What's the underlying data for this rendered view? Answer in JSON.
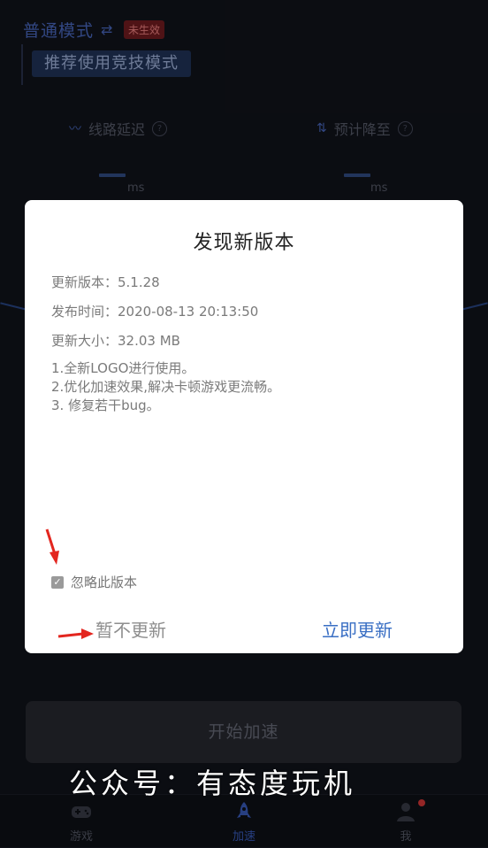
{
  "mode": {
    "title": "普通模式",
    "badge": "未生效",
    "recommend_button": "推荐使用竞技模式"
  },
  "stats": {
    "left_label": "线路延迟",
    "right_label": "预计降至",
    "left_value": "--",
    "right_value": "--",
    "left_unit": "ms",
    "right_unit": "ms"
  },
  "start_button": "开始加速",
  "tabs": [
    {
      "label": "游戏",
      "icon": "gamepad-icon"
    },
    {
      "label": "加速",
      "icon": "rocket-icon"
    },
    {
      "label": "我",
      "icon": "user-icon"
    }
  ],
  "dialog": {
    "title": "发现新版本",
    "version_line": "更新版本：5.1.28",
    "time_line": "发布时间：2020-08-13 20:13:50",
    "size_line": "更新大小：32.03 MB",
    "notes": [
      "1.全新LOGO进行使用。",
      "2.优化加速效果,解决卡顿游戏更流畅。",
      "3. 修复若干bug。"
    ],
    "ignore_label": "忽略此版本",
    "ignore_checked": true,
    "later_button": "暂不更新",
    "update_button": "立即更新"
  },
  "watermark": "公众号：有态度玩机",
  "colors": {
    "accent": "#3a6fc4",
    "badge_bg": "#7a1e22",
    "annotation_arrow": "#e3261f"
  }
}
